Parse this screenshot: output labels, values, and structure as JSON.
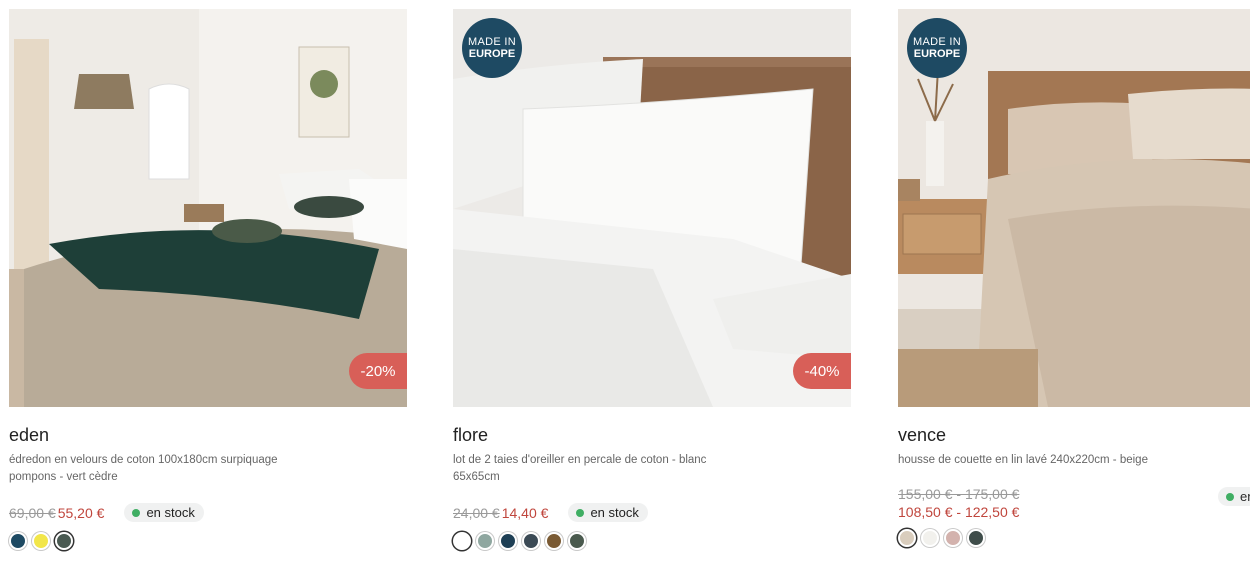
{
  "products": [
    {
      "name": "eden",
      "description": "édredon en velours de coton 100x180cm surpiquage pompons - vert cèdre",
      "old_price": "69,00 €",
      "new_price": "55,20 €",
      "stock": "en stock",
      "discount": "-20%",
      "swatches": [
        "#1e4a63",
        "#f2e64a",
        "#4a5a52"
      ]
    },
    {
      "name": "flore",
      "description": "lot de 2 taies d'oreiller en percale de coton - blanc 65x65cm",
      "old_price": "24,00 €",
      "new_price": "14,40 €",
      "stock": "en stock",
      "discount": "-40%",
      "badge_line1": "MADE IN",
      "badge_line2": "EUROPE",
      "swatches": [
        "#ffffff",
        "#8fa7a0",
        "#1e3f55",
        "#3b4a55",
        "#7a5a33",
        "#4a5a4e"
      ]
    },
    {
      "name": "vence",
      "description": "housse de couette en lin lavé 240x220cm - beige",
      "old_price": "155,00 € - 175,00 €",
      "new_price": "108,50 € - 122,50 €",
      "stock": "en",
      "badge_line1": "MADE IN",
      "badge_line2": "EUROPE",
      "swatches": [
        "#d9cdbd",
        "#f2f1ed",
        "#d3b2ad",
        "#3f4d4a"
      ]
    }
  ],
  "colors": {
    "accent": "#c0463d",
    "badge": "#1e4a63",
    "discount": "#d85f58",
    "in_stock": "#3fae63"
  }
}
